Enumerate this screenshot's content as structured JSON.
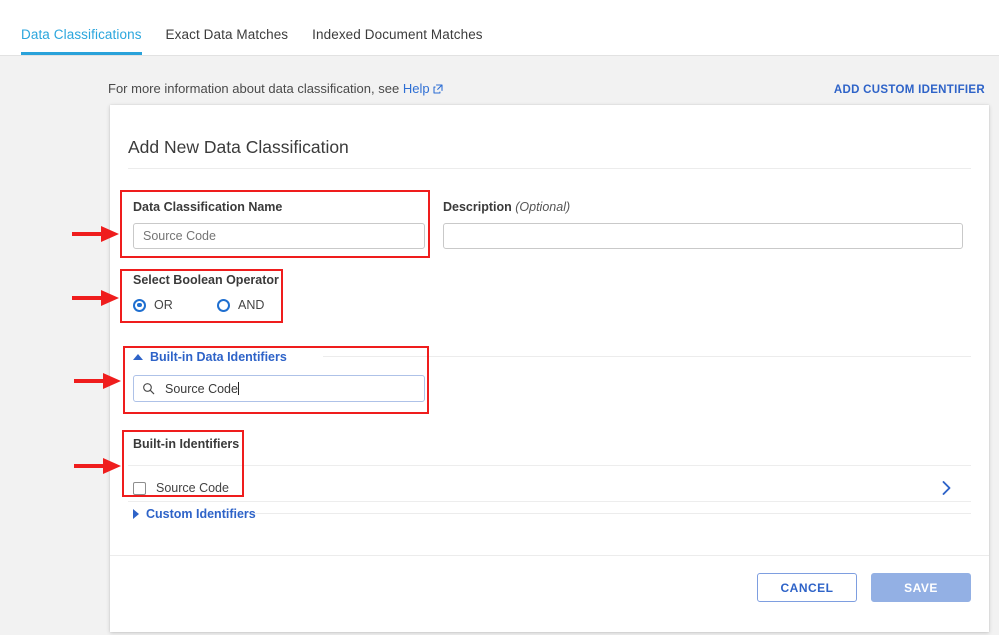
{
  "tabs": [
    {
      "label": "Data Classifications",
      "active": true
    },
    {
      "label": "Exact Data Matches",
      "active": false
    },
    {
      "label": "Indexed Document Matches",
      "active": false
    }
  ],
  "subheader": {
    "text_before": "For more information about data classification, see",
    "help_label": "Help",
    "external_link_icon": "external-link-icon",
    "add_custom_identifier": "ADD CUSTOM IDENTIFIER"
  },
  "card": {
    "title": "Add New Data Classification",
    "name_field": {
      "label": "Data Classification Name",
      "value": "Source Code",
      "placeholder": "Source Code"
    },
    "description_field": {
      "label": "Description",
      "optional": "(Optional)",
      "value": "",
      "placeholder": ""
    },
    "boolean_operator": {
      "label": "Select Boolean Operator",
      "options": [
        {
          "label": "OR",
          "selected": true
        },
        {
          "label": "AND",
          "selected": false
        }
      ]
    },
    "builtin_data_identifiers": {
      "title": "Built-in Data Identifiers",
      "expanded": true,
      "caret_icon": "caret-up-icon",
      "search": {
        "icon": "search-icon",
        "value": "Source Code",
        "placeholder": "Search"
      }
    },
    "builtin_identifiers": {
      "title": "Built-in Identifiers",
      "rows": [
        {
          "label": "Source Code",
          "checked": false,
          "expand_icon": "chevron-right-icon"
        }
      ]
    },
    "custom_identifiers": {
      "title": "Custom Identifiers",
      "expanded": false,
      "caret_icon": "caret-right-icon"
    },
    "footer": {
      "cancel_label": "CANCEL",
      "save_label": "SAVE"
    }
  },
  "colors": {
    "accent_tab": "#29a2da",
    "link_blue": "#2e63c8",
    "save_disabled": "#93b0e4",
    "annotation_red": "#ef1d1d",
    "page_bg": "#f2f2f2"
  },
  "annotations": {
    "arrow_icon": "red-arrow-right",
    "box_icon": "red-highlight-box",
    "count": 4
  }
}
